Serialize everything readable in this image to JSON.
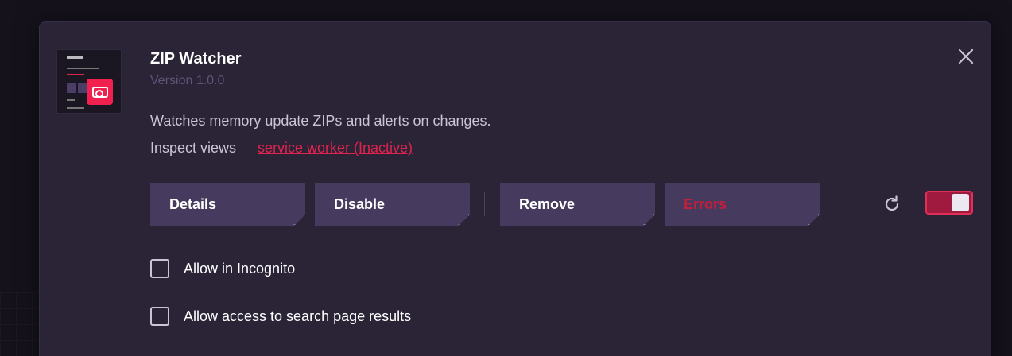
{
  "extension": {
    "name": "ZIP Watcher",
    "version": "Version 1.0.0",
    "description": "Watches memory update ZIPs and alerts on changes.",
    "inspect_label": "Inspect views",
    "inspect_link": "service worker (Inactive)"
  },
  "actions": {
    "details": "Details",
    "disable": "Disable",
    "remove": "Remove",
    "errors": "Errors"
  },
  "toggle": {
    "enabled": true
  },
  "options": [
    {
      "label": "Allow in Incognito",
      "checked": false
    },
    {
      "label": "Allow access to search page results",
      "checked": false
    }
  ],
  "icons": {
    "close": "close-icon",
    "reload": "reload-icon",
    "thumbnail": "extension-thumbnail"
  },
  "colors": {
    "accent": "#e0234e",
    "button_bg": "#463a5e",
    "card_bg": "#2a2436"
  }
}
